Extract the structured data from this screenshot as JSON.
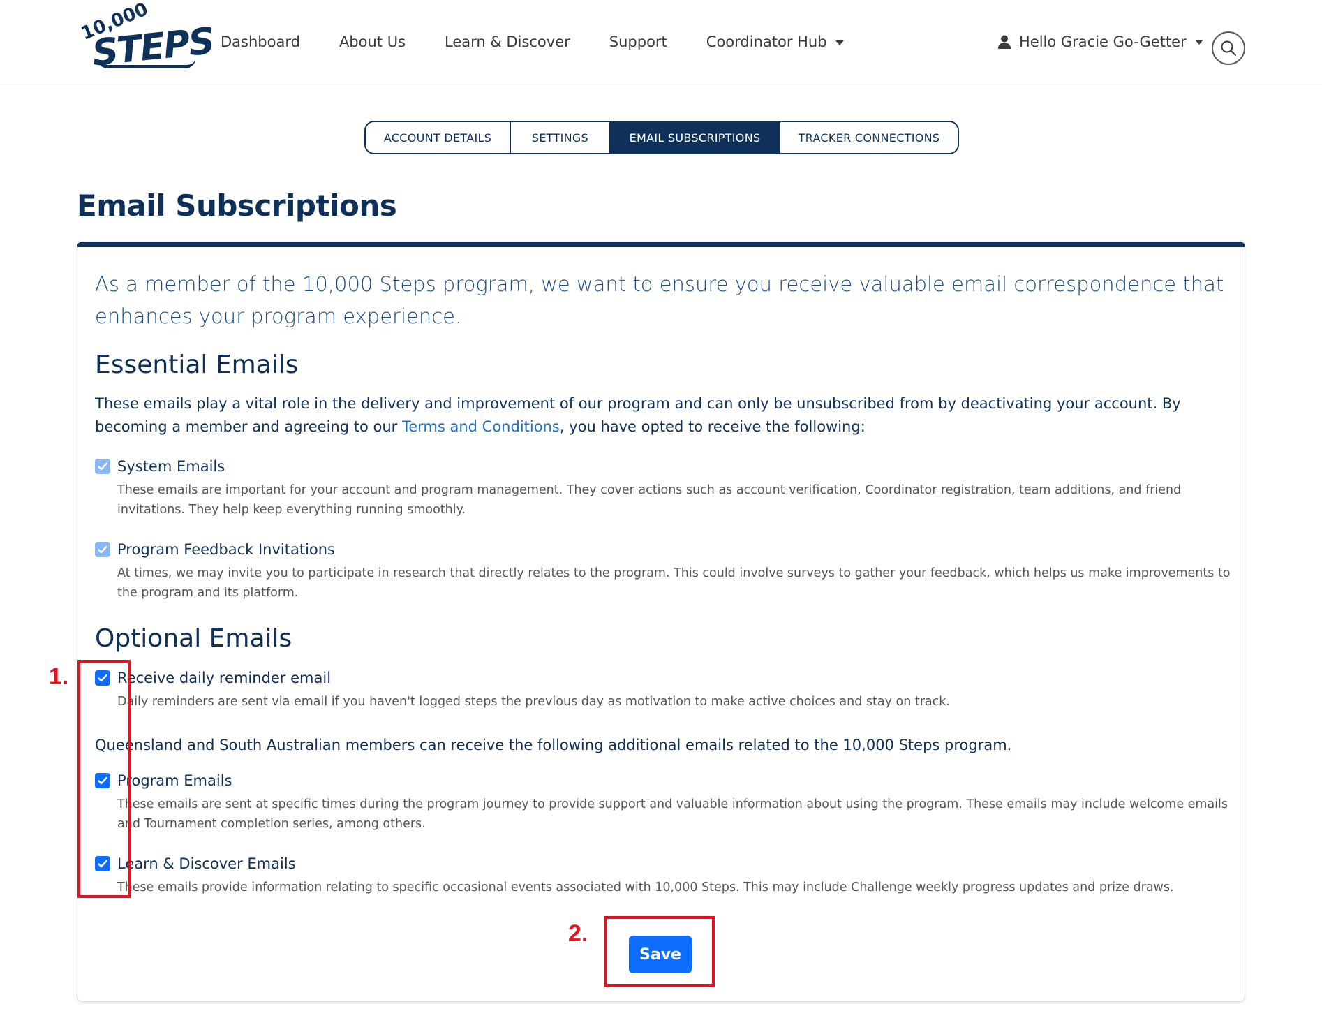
{
  "header": {
    "logo": {
      "small_text": "10,000",
      "word": "STEPS"
    },
    "nav": [
      {
        "label": "Dashboard"
      },
      {
        "label": "About Us"
      },
      {
        "label": "Learn & Discover"
      },
      {
        "label": "Support"
      },
      {
        "label": "Coordinator Hub",
        "dropdown": true
      }
    ],
    "user_menu": {
      "label": "Hello Gracie Go-Getter",
      "icon": "user-icon"
    },
    "search_icon": "search-icon"
  },
  "tabs": [
    {
      "label": "ACCOUNT DETAILS",
      "active": false
    },
    {
      "label": "SETTINGS",
      "active": false
    },
    {
      "label": "EMAIL SUBSCRIPTIONS",
      "active": true
    },
    {
      "label": "TRACKER CONNECTIONS",
      "active": false
    }
  ],
  "page": {
    "title": "Email Subscriptions",
    "intro": "As a member of the 10,000 Steps program, we want to ensure you receive valuable email correspondence that enhances your program experience.",
    "essential": {
      "heading": "Essential Emails",
      "text_before_link": "These emails play a vital role in the delivery and improvement of our program and can only be unsubscribed from by deactivating your account. By becoming a member and agreeing to our ",
      "link": "Terms and Conditions",
      "text_after_link": ", you have opted to receive the following:",
      "options": [
        {
          "label": "System Emails",
          "checked": true,
          "disabled": true,
          "description": "These emails are important for your account and program management. They cover actions such as account verification, Coordinator registration, team additions, and friend invitations. They help keep everything running smoothly."
        },
        {
          "label": "Program Feedback Invitations",
          "checked": true,
          "disabled": true,
          "description": "At times, we may invite you to participate in research that directly relates to the program. This could involve surveys to gather your feedback, which helps us make improvements to the program and its platform."
        }
      ]
    },
    "optional": {
      "heading": "Optional Emails",
      "daily": {
        "label": "Receive daily reminder email",
        "checked": true,
        "description": "Daily reminders are sent via email if you haven't logged steps the previous day as motivation to make active choices and stay on track."
      },
      "regional_note": "Queensland and South Australian members can receive the following additional emails related to the 10,000 Steps program.",
      "program": {
        "label": "Program Emails",
        "checked": true,
        "description": "These emails are sent at specific times during the program journey to provide support and valuable information about using the program. These emails may include welcome emails and Tournament completion series, among others."
      },
      "learn": {
        "label": "Learn & Discover Emails",
        "checked": true,
        "description": "These emails provide information relating to specific occasional events associated with 10,000 Steps. This may include Challenge weekly progress updates and prize draws."
      }
    },
    "save_label": "Save"
  },
  "annotations": {
    "label_1": "1.",
    "label_2": "2.",
    "color": "#e0141e"
  },
  "colors": {
    "brand_navy": "#0f3159",
    "primary_blue": "#0d6efd",
    "link_blue": "#1a73c8"
  }
}
